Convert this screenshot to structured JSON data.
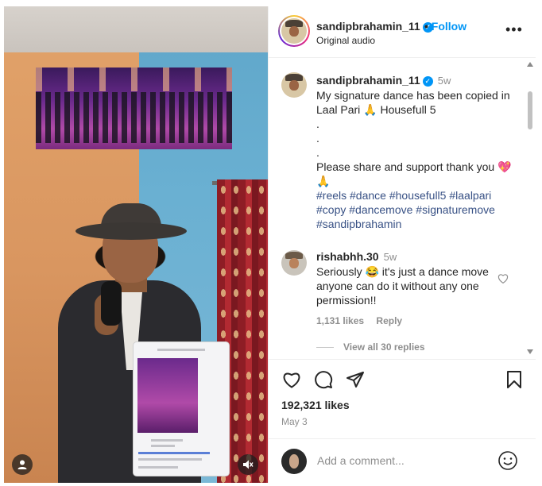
{
  "post": {
    "username": "sandipbrahamin_11",
    "verified_glyph": "✓",
    "follow_separator": "•",
    "follow_label": "Follow",
    "audio": "Original audio",
    "more_glyph": "•••"
  },
  "caption": {
    "username": "sandipbrahamin_11",
    "time": "5w",
    "line1": "My signature dance has been copied in",
    "line2": "Laal Pari 🙏 Housefull 5",
    "dot1": ".",
    "dot2": ".",
    "dot3": ".",
    "line3": "Please share and support thank you 💖",
    "line4": "🙏",
    "hashtags_line1": "#reels #dance #housefull5 #laalpari",
    "hashtags_line2": "#copy #dancemove #signaturemove",
    "hashtags_line3": "#sandipbrahamin"
  },
  "comment": {
    "username": "rishabhh.30",
    "time": "5w",
    "line1": "Seriously 😂 it's just a dance move",
    "line2": "anyone can do it without any one",
    "line3": "permission!!",
    "likes": "1,131 likes",
    "reply": "Reply",
    "view_replies": "View all 30 replies"
  },
  "actions": {
    "likes": "192,321 likes",
    "date": "May 3",
    "icons": [
      "heart-icon",
      "comment-icon",
      "share-icon",
      "bookmark-icon"
    ]
  },
  "add_comment": {
    "placeholder": "Add a comment..."
  },
  "colors": {
    "accent": "#0095f6",
    "hashtag": "#385185",
    "muted": "#8e8e8e"
  }
}
